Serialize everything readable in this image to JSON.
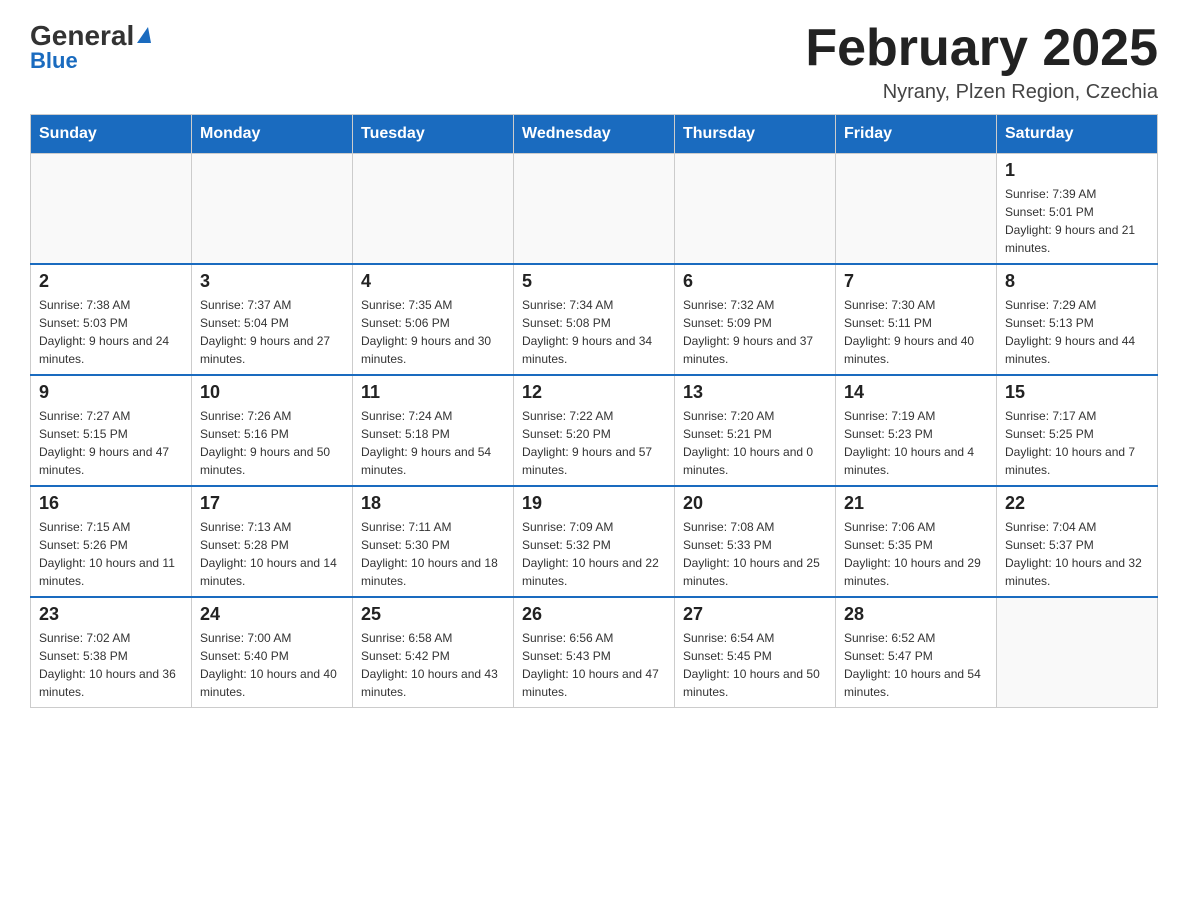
{
  "header": {
    "logo_general": "General",
    "logo_blue": "Blue",
    "month_title": "February 2025",
    "location": "Nyrany, Plzen Region, Czechia"
  },
  "days_of_week": [
    "Sunday",
    "Monday",
    "Tuesday",
    "Wednesday",
    "Thursday",
    "Friday",
    "Saturday"
  ],
  "weeks": [
    {
      "cells": [
        {
          "empty": true
        },
        {
          "empty": true
        },
        {
          "empty": true
        },
        {
          "empty": true
        },
        {
          "empty": true
        },
        {
          "empty": true
        },
        {
          "day": "1",
          "sunrise": "Sunrise: 7:39 AM",
          "sunset": "Sunset: 5:01 PM",
          "daylight": "Daylight: 9 hours and 21 minutes."
        }
      ]
    },
    {
      "cells": [
        {
          "day": "2",
          "sunrise": "Sunrise: 7:38 AM",
          "sunset": "Sunset: 5:03 PM",
          "daylight": "Daylight: 9 hours and 24 minutes."
        },
        {
          "day": "3",
          "sunrise": "Sunrise: 7:37 AM",
          "sunset": "Sunset: 5:04 PM",
          "daylight": "Daylight: 9 hours and 27 minutes."
        },
        {
          "day": "4",
          "sunrise": "Sunrise: 7:35 AM",
          "sunset": "Sunset: 5:06 PM",
          "daylight": "Daylight: 9 hours and 30 minutes."
        },
        {
          "day": "5",
          "sunrise": "Sunrise: 7:34 AM",
          "sunset": "Sunset: 5:08 PM",
          "daylight": "Daylight: 9 hours and 34 minutes."
        },
        {
          "day": "6",
          "sunrise": "Sunrise: 7:32 AM",
          "sunset": "Sunset: 5:09 PM",
          "daylight": "Daylight: 9 hours and 37 minutes."
        },
        {
          "day": "7",
          "sunrise": "Sunrise: 7:30 AM",
          "sunset": "Sunset: 5:11 PM",
          "daylight": "Daylight: 9 hours and 40 minutes."
        },
        {
          "day": "8",
          "sunrise": "Sunrise: 7:29 AM",
          "sunset": "Sunset: 5:13 PM",
          "daylight": "Daylight: 9 hours and 44 minutes."
        }
      ]
    },
    {
      "cells": [
        {
          "day": "9",
          "sunrise": "Sunrise: 7:27 AM",
          "sunset": "Sunset: 5:15 PM",
          "daylight": "Daylight: 9 hours and 47 minutes."
        },
        {
          "day": "10",
          "sunrise": "Sunrise: 7:26 AM",
          "sunset": "Sunset: 5:16 PM",
          "daylight": "Daylight: 9 hours and 50 minutes."
        },
        {
          "day": "11",
          "sunrise": "Sunrise: 7:24 AM",
          "sunset": "Sunset: 5:18 PM",
          "daylight": "Daylight: 9 hours and 54 minutes."
        },
        {
          "day": "12",
          "sunrise": "Sunrise: 7:22 AM",
          "sunset": "Sunset: 5:20 PM",
          "daylight": "Daylight: 9 hours and 57 minutes."
        },
        {
          "day": "13",
          "sunrise": "Sunrise: 7:20 AM",
          "sunset": "Sunset: 5:21 PM",
          "daylight": "Daylight: 10 hours and 0 minutes."
        },
        {
          "day": "14",
          "sunrise": "Sunrise: 7:19 AM",
          "sunset": "Sunset: 5:23 PM",
          "daylight": "Daylight: 10 hours and 4 minutes."
        },
        {
          "day": "15",
          "sunrise": "Sunrise: 7:17 AM",
          "sunset": "Sunset: 5:25 PM",
          "daylight": "Daylight: 10 hours and 7 minutes."
        }
      ]
    },
    {
      "cells": [
        {
          "day": "16",
          "sunrise": "Sunrise: 7:15 AM",
          "sunset": "Sunset: 5:26 PM",
          "daylight": "Daylight: 10 hours and 11 minutes."
        },
        {
          "day": "17",
          "sunrise": "Sunrise: 7:13 AM",
          "sunset": "Sunset: 5:28 PM",
          "daylight": "Daylight: 10 hours and 14 minutes."
        },
        {
          "day": "18",
          "sunrise": "Sunrise: 7:11 AM",
          "sunset": "Sunset: 5:30 PM",
          "daylight": "Daylight: 10 hours and 18 minutes."
        },
        {
          "day": "19",
          "sunrise": "Sunrise: 7:09 AM",
          "sunset": "Sunset: 5:32 PM",
          "daylight": "Daylight: 10 hours and 22 minutes."
        },
        {
          "day": "20",
          "sunrise": "Sunrise: 7:08 AM",
          "sunset": "Sunset: 5:33 PM",
          "daylight": "Daylight: 10 hours and 25 minutes."
        },
        {
          "day": "21",
          "sunrise": "Sunrise: 7:06 AM",
          "sunset": "Sunset: 5:35 PM",
          "daylight": "Daylight: 10 hours and 29 minutes."
        },
        {
          "day": "22",
          "sunrise": "Sunrise: 7:04 AM",
          "sunset": "Sunset: 5:37 PM",
          "daylight": "Daylight: 10 hours and 32 minutes."
        }
      ]
    },
    {
      "cells": [
        {
          "day": "23",
          "sunrise": "Sunrise: 7:02 AM",
          "sunset": "Sunset: 5:38 PM",
          "daylight": "Daylight: 10 hours and 36 minutes."
        },
        {
          "day": "24",
          "sunrise": "Sunrise: 7:00 AM",
          "sunset": "Sunset: 5:40 PM",
          "daylight": "Daylight: 10 hours and 40 minutes."
        },
        {
          "day": "25",
          "sunrise": "Sunrise: 6:58 AM",
          "sunset": "Sunset: 5:42 PM",
          "daylight": "Daylight: 10 hours and 43 minutes."
        },
        {
          "day": "26",
          "sunrise": "Sunrise: 6:56 AM",
          "sunset": "Sunset: 5:43 PM",
          "daylight": "Daylight: 10 hours and 47 minutes."
        },
        {
          "day": "27",
          "sunrise": "Sunrise: 6:54 AM",
          "sunset": "Sunset: 5:45 PM",
          "daylight": "Daylight: 10 hours and 50 minutes."
        },
        {
          "day": "28",
          "sunrise": "Sunrise: 6:52 AM",
          "sunset": "Sunset: 5:47 PM",
          "daylight": "Daylight: 10 hours and 54 minutes."
        },
        {
          "empty": true
        }
      ]
    }
  ]
}
